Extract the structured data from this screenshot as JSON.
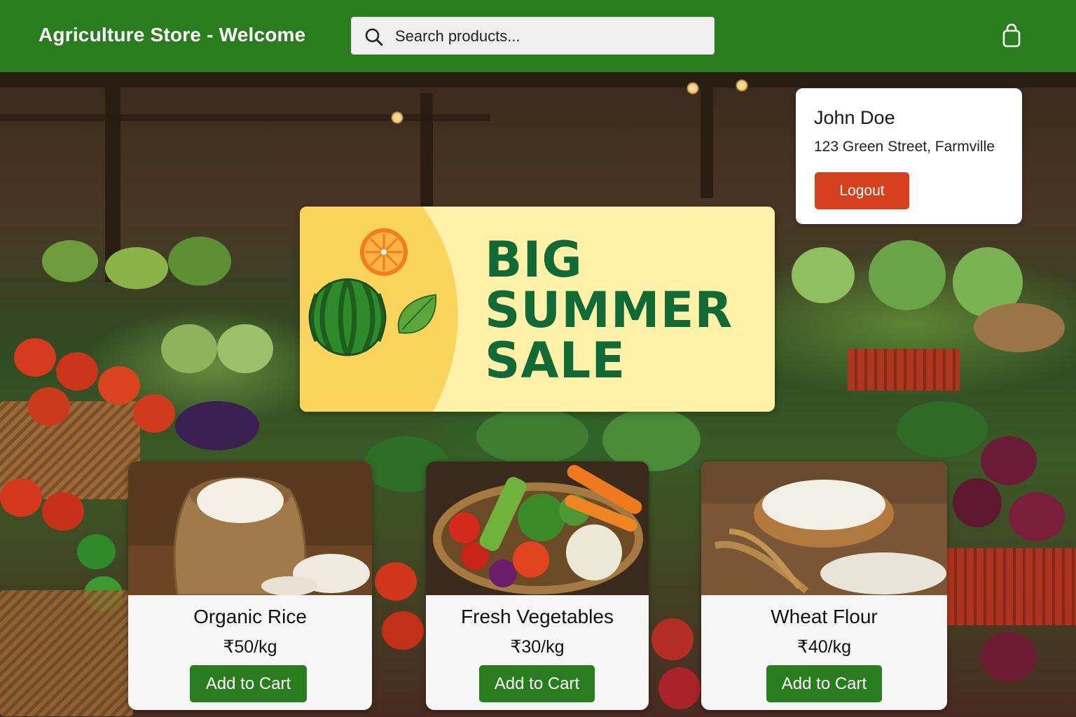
{
  "header": {
    "title": "Agriculture Store - Welcome",
    "search_placeholder": "Search products...",
    "search_icon": "search-icon",
    "cart_icon": "shopping-bag-icon"
  },
  "user": {
    "name": "John Doe",
    "address": "123 Green Street, Farmville",
    "logout_label": "Logout"
  },
  "banner": {
    "lines": [
      "BIG",
      "SUMMER",
      "SALE"
    ],
    "icons": [
      "orange-slice-icon",
      "watermelon-icon",
      "leaf-icon"
    ]
  },
  "products": [
    {
      "name": "Organic Rice",
      "price": "₹50/kg",
      "button": "Add to Cart",
      "image": "rice-sack-image"
    },
    {
      "name": "Fresh Vegetables",
      "price": "₹30/kg",
      "button": "Add to Cart",
      "image": "vegetable-basket-image"
    },
    {
      "name": "Wheat Flour",
      "price": "₹40/kg",
      "button": "Add to Cart",
      "image": "flour-bowl-image"
    }
  ],
  "colors": {
    "brand_green": "#2a7d1f",
    "logout_red": "#d6401f",
    "banner_bg": "#fff2a8",
    "banner_text": "#0f6a35"
  }
}
